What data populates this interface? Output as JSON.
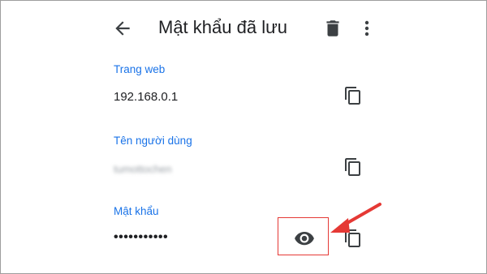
{
  "header": {
    "title": "Mật khẩu đã lưu",
    "back_icon": "arrow-back-icon",
    "delete_icon": "trash-icon",
    "more_icon": "more-vert-icon"
  },
  "fields": {
    "website": {
      "label": "Trang web",
      "value": "192.168.0.1",
      "copy_icon": "copy-icon"
    },
    "username": {
      "label": "Tên người dùng",
      "value": "tumottochen",
      "copy_icon": "copy-icon"
    },
    "password": {
      "label": "Mật khẩu",
      "value": "•••••••••••",
      "show_icon": "eye-icon",
      "copy_icon": "copy-icon"
    }
  },
  "colors": {
    "accent": "#1a73e8",
    "text": "#202124",
    "icon": "#3c4043",
    "annotation": "#e53935"
  }
}
